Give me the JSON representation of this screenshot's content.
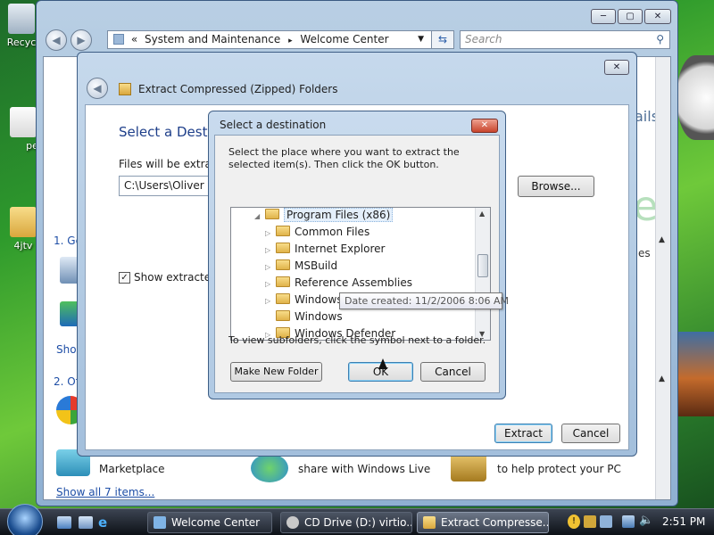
{
  "desktop": {
    "icons": [
      {
        "label": "Recyc"
      },
      {
        "label": "pe"
      },
      {
        "label": "4jtv"
      }
    ]
  },
  "welcome_window": {
    "breadcrumb_prefix": "«",
    "breadcrumb_part1": "System and Maintenance",
    "breadcrumb_sep": "▸",
    "breadcrumb_part2": "Welcome Center",
    "search_placeholder": "Search",
    "side_text_1": "ails",
    "side_text_2": "es",
    "side_text_3": "e",
    "section1_prefix": "1. Ge",
    "section2_prefix": "2. Of",
    "show_link_partial": "Show",
    "marketplace_label": "Marketplace",
    "share_label": "share with Windows Live",
    "protect_label": "to help protect your PC",
    "show_all_link": "Show all 7 items..."
  },
  "extract_dialog": {
    "title": "Extract Compressed (Zipped) Folders",
    "heading_partial": "Select a Destin",
    "files_label_partial": "Files will be extracte",
    "path_value": "C:\\Users\\Oliver Fre",
    "browse_label": "Browse...",
    "show_extracted_partial": "Show extracted f",
    "extract_button": "Extract",
    "cancel_button": "Cancel"
  },
  "select_destination": {
    "title": "Select a destination",
    "close_label": "✕",
    "instruction": "Select the place where you want to extract the selected item(s).  Then click the OK button.",
    "tree_items": [
      {
        "label": "Program Files (x86)",
        "expander": "◢"
      },
      {
        "label": "Common Files",
        "expander": "▷"
      },
      {
        "label": "Internet Explorer",
        "expander": "▷"
      },
      {
        "label": "MSBuild",
        "expander": "▷"
      },
      {
        "label": "Reference Assemblies",
        "expander": "▷"
      },
      {
        "label": "Windows Calendar",
        "expander": "▷"
      },
      {
        "label": "Windows",
        "expander": ""
      },
      {
        "label": "Windows Defender",
        "expander": "▷"
      }
    ],
    "tooltip": "Date created: 11/2/2006 8:06 AM",
    "hint": "To view subfolders, click the symbol next to a folder.",
    "make_new_folder": "Make New Folder",
    "ok_label": "OK",
    "cancel_label": "Cancel"
  },
  "taskbar": {
    "tasks": [
      {
        "label": "Welcome Center"
      },
      {
        "label": "CD Drive (D:) virtio..."
      },
      {
        "label": "Extract Compresse..."
      }
    ],
    "clock": "2:51 PM"
  }
}
